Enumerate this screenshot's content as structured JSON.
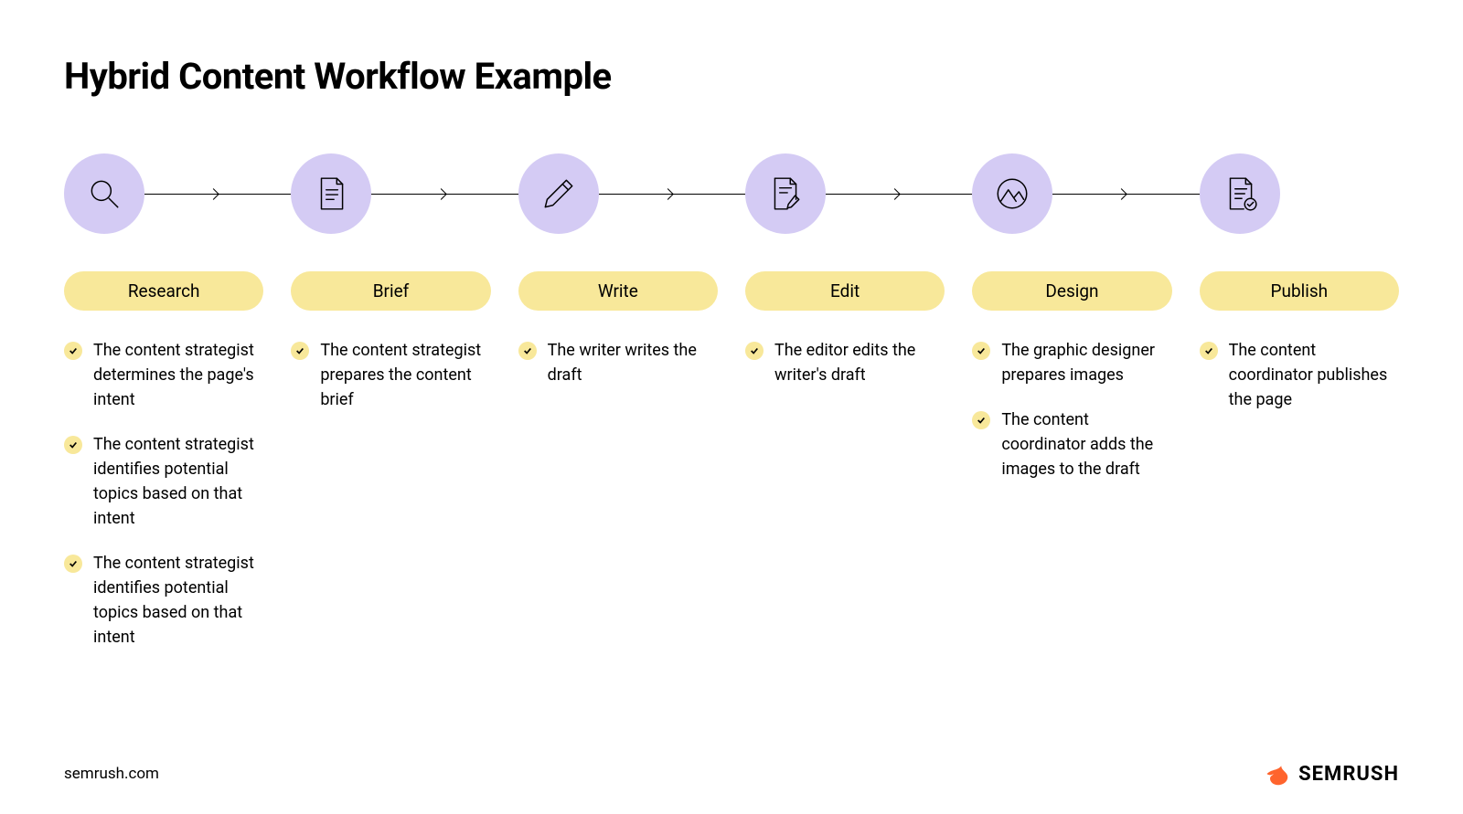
{
  "title": "Hybrid Content Workflow Example",
  "stages": [
    {
      "icon": "search",
      "label": "Research",
      "items": [
        "The content strategist determines the page's intent",
        "The content strategist identifies potential topics based on that intent",
        "The content strategist identifies potential topics based on that intent"
      ]
    },
    {
      "icon": "document",
      "label": "Brief",
      "items": [
        "The content strategist prepares the content brief"
      ]
    },
    {
      "icon": "pencil",
      "label": "Write",
      "items": [
        "The writer writes the draft"
      ]
    },
    {
      "icon": "doc-edit",
      "label": "Edit",
      "items": [
        "The editor edits the writer's draft"
      ]
    },
    {
      "icon": "image",
      "label": "Design",
      "items": [
        "The graphic designer prepares images",
        "The content coordinator adds the images to the draft"
      ]
    },
    {
      "icon": "doc-check",
      "label": "Publish",
      "items": [
        "The content coordinator publishes the page"
      ]
    }
  ],
  "footer": {
    "domain": "semrush.com",
    "brand": "SEMRUSH"
  }
}
